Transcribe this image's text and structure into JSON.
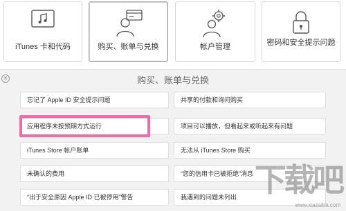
{
  "categories": [
    {
      "label": "iTunes 卡和代码",
      "icon": "music-note-icon",
      "selected": false
    },
    {
      "label": "购买、账单与兑换",
      "icon": "person-card-icon",
      "selected": true
    },
    {
      "label": "帐户管理",
      "icon": "person-gear-icon",
      "selected": false
    },
    {
      "label": "密码和安全提示问题",
      "icon": "lock-icon",
      "selected": false
    }
  ],
  "panel": {
    "title": "购买、账单与兑换",
    "close_glyph": "✕"
  },
  "questions": {
    "left": [
      "忘记了 Apple ID 安全提示问题",
      "应用程序未按预期方式运行",
      "iTunes Store 帐户账单",
      "未确认的费用",
      "“出于安全原因 Apple ID 已被停用”警告"
    ],
    "right": [
      "共享的付款和询问购买",
      "项目可以播放，但看起来或听起来有问题",
      "无法从 iTunes Store 购买",
      "“您的信用卡已被拒绝”消息",
      "我遇到的问题未列出"
    ]
  },
  "watermark": {
    "big": "下载吧",
    "small": "www.xiazaiba.com"
  }
}
